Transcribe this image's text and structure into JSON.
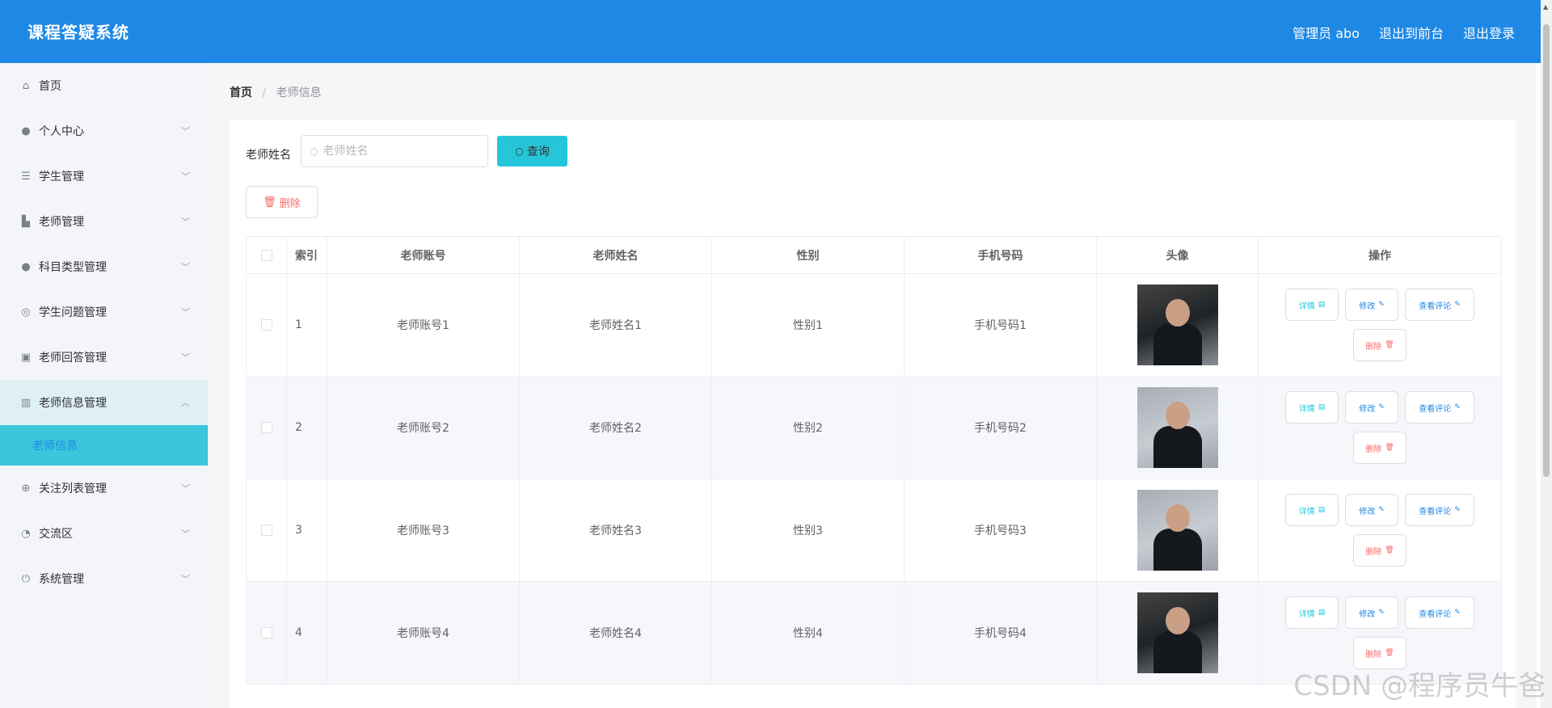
{
  "header": {
    "title": "课程答疑系统",
    "user": "管理员 abo",
    "to_front": "退出到前台",
    "logout": "退出登录"
  },
  "sidebar": {
    "items": [
      {
        "label": "首页",
        "icon": "home-icon",
        "glyph": "⌂"
      },
      {
        "label": "个人中心",
        "icon": "user-icon",
        "glyph": "●"
      },
      {
        "label": "学生管理",
        "icon": "list-icon",
        "glyph": "☰"
      },
      {
        "label": "老师管理",
        "icon": "teacher-icon",
        "glyph": "▙"
      },
      {
        "label": "科目类型管理",
        "icon": "person-icon",
        "glyph": "●"
      },
      {
        "label": "学生问题管理",
        "icon": "compass-icon",
        "glyph": "◎"
      },
      {
        "label": "老师回答管理",
        "icon": "clipboard-icon",
        "glyph": "▣"
      },
      {
        "label": "老师信息管理",
        "icon": "books-icon",
        "glyph": "▥"
      },
      {
        "label": "关注列表管理",
        "icon": "target-icon",
        "glyph": "⊕"
      },
      {
        "label": "交流区",
        "icon": "gauge-icon",
        "glyph": "◔"
      },
      {
        "label": "系统管理",
        "icon": "power-icon",
        "glyph": "⏻"
      }
    ],
    "sub_item": "老师信息"
  },
  "breadcrumb": {
    "home": "首页",
    "separator": "/",
    "current": "老师信息"
  },
  "search": {
    "label": "老师姓名",
    "placeholder": "老师姓名",
    "button": "查询"
  },
  "toolbar": {
    "delete": "删除"
  },
  "table": {
    "headers": [
      "索引",
      "老师账号",
      "老师姓名",
      "性别",
      "手机号码",
      "头像",
      "操作"
    ],
    "rows": [
      {
        "index": "1",
        "account": "老师账号1",
        "name": "老师姓名1",
        "gender": "性别1",
        "phone": "手机号码1"
      },
      {
        "index": "2",
        "account": "老师账号2",
        "name": "老师姓名2",
        "gender": "性别2",
        "phone": "手机号码2"
      },
      {
        "index": "3",
        "account": "老师账号3",
        "name": "老师姓名3",
        "gender": "性别3",
        "phone": "手机号码3"
      },
      {
        "index": "4",
        "account": "老师账号4",
        "name": "老师姓名4",
        "gender": "性别4",
        "phone": "手机号码4"
      }
    ],
    "actions": {
      "detail": "详情",
      "edit": "修改",
      "review": "查看评论",
      "delete": "删除"
    }
  },
  "watermark": "CSDN @程序员牛爸",
  "colors": {
    "header_bg": "#1e88e5",
    "accent": "#26c6da",
    "danger": "#f56c6c"
  }
}
